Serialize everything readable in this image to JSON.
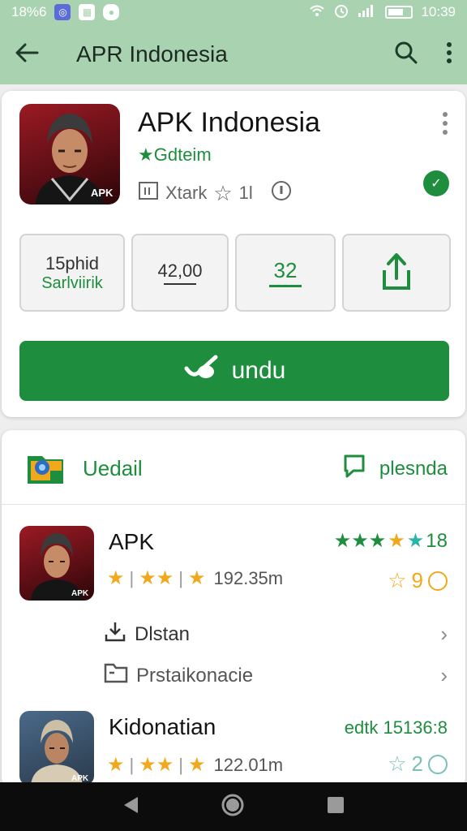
{
  "status_bar": {
    "left_text": "18%6",
    "time": "10:39"
  },
  "app_bar": {
    "title": "APR Indonesia",
    "icons": [
      "back-arrow-icon",
      "search-icon",
      "more-vert-icon"
    ]
  },
  "app_detail": {
    "name": "APK Indonesia",
    "developer": "Gdteim",
    "meta_text": "Xtark",
    "meta_rating": "1l",
    "stats": [
      {
        "line1": "15phid",
        "line2": "Sarlviirik"
      },
      {
        "line1": "42,00",
        "line2": ""
      },
      {
        "line1": "32",
        "line2": ""
      },
      {
        "line1": "",
        "line2": "",
        "icon": "share-icon"
      }
    ],
    "install_label": "undu",
    "colors": {
      "accent": "#1e8e3e",
      "header": "#a9d3b0"
    }
  },
  "section": {
    "left_label": "Uedail",
    "right_label": "plesnda"
  },
  "list": [
    {
      "name": "APK",
      "small_stars": "★★★",
      "size": "192.35m",
      "top_stars": "★★★★★",
      "top_count": "18",
      "score": "9",
      "sub_rows": [
        {
          "icon": "download-icon",
          "label": "Dlstan"
        },
        {
          "icon": "folder-icon",
          "label": "Prstaikonacie"
        }
      ]
    },
    {
      "name": "Kidonatian",
      "small_stars": "★★★",
      "size": "122.01m",
      "top_text": "edtk 15136:8",
      "score": "2"
    }
  ],
  "nav_bar": {
    "icons": [
      "back-triangle-icon",
      "home-circle-icon",
      "recents-square-icon"
    ]
  }
}
